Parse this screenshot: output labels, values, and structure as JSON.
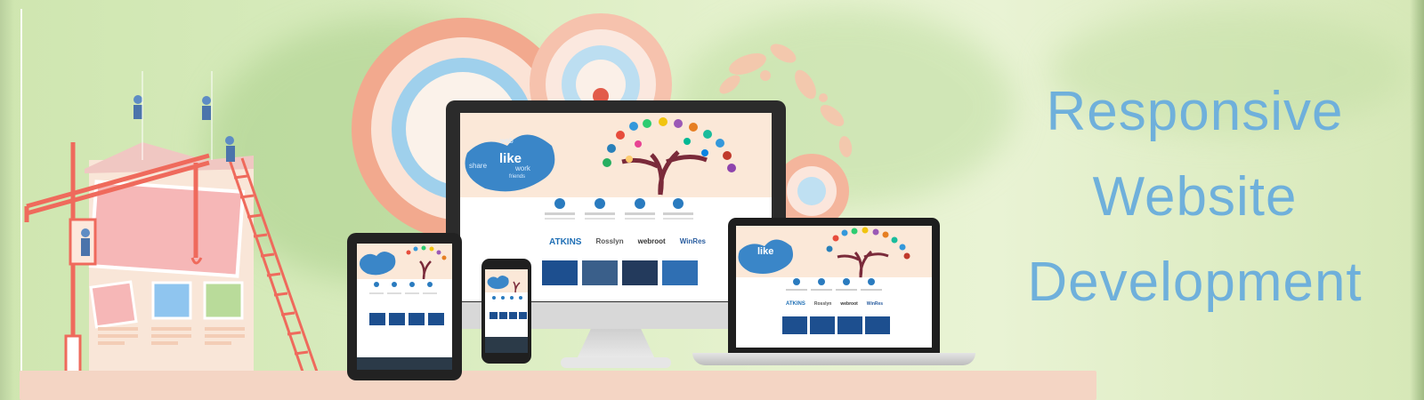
{
  "headline": {
    "line1": "Responsive",
    "line2": "Website",
    "line3": "Development"
  },
  "colors": {
    "background": "#d9ecbf",
    "headline": "#6fb0db",
    "target_ring": "#f2a98e",
    "target_inner": "#9fd0ec",
    "crane": "#ef6a5c",
    "floor": "#f4d5c4",
    "device_frame": "#2b2b2b"
  },
  "screen_content": {
    "hero_bubble_word": "like",
    "bubble_words": [
      "web",
      "share",
      "work",
      "friends"
    ],
    "partner_logos": [
      "ATKINS",
      "Rosslyn",
      "webroot",
      "WinRes"
    ]
  },
  "icons": [
    "crane-icon",
    "ladder-icon",
    "worker-figure-icon",
    "target-rings-icon",
    "social-tree-icon",
    "flower-ornament-icon"
  ]
}
